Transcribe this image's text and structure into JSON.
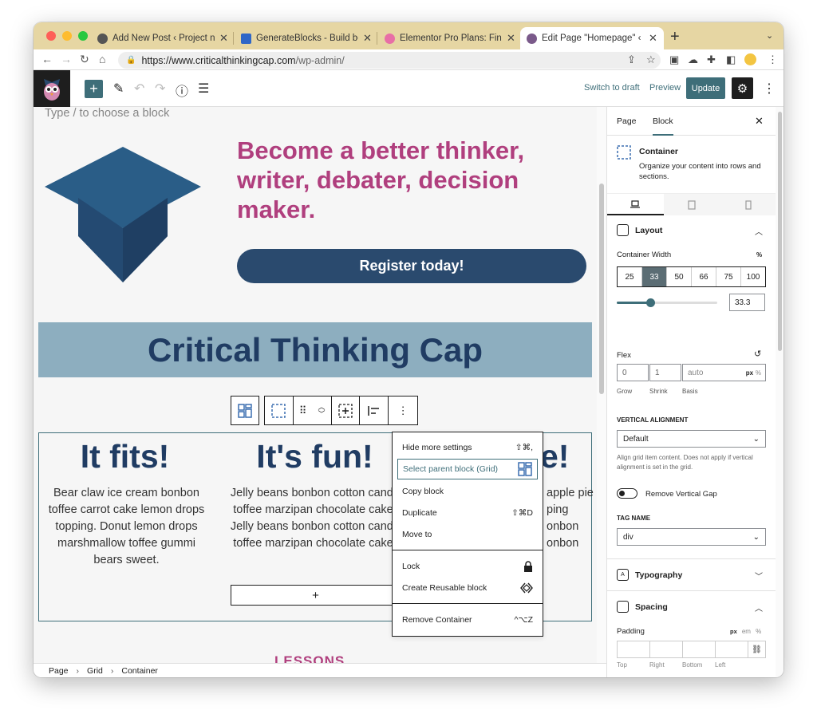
{
  "browser": {
    "tabs": [
      {
        "title": "Add New Post ‹ Project notes",
        "favicon_color": "#555555"
      },
      {
        "title": "GenerateBlocks - Build better",
        "favicon_color": "#2f67c7"
      },
      {
        "title": "Elementor Pro Plans: Find The",
        "favicon_color": "#e86fa6"
      },
      {
        "title": "Edit Page \"Homepage\" ‹ Critic",
        "favicon_color": "#7a5a8a"
      }
    ],
    "url_host": "https://www.criticalthinkingcap.com",
    "url_path": "/wp-admin/"
  },
  "wp_toolbar": {
    "switch_to_draft": "Switch to draft",
    "preview": "Preview",
    "update": "Update"
  },
  "canvas": {
    "type_hint": "Type / to choose a block",
    "headline": "Become a better thinker, writer, debater, decision maker.",
    "register_button": "Register today!",
    "banner_title": "Critical Thinking Cap",
    "columns": [
      {
        "heading": "It fits!",
        "body": "Bear claw ice cream bonbon toffee carrot cake lemon drops topping. Donut lemon drops marshmallow toffee gummi bears sweet."
      },
      {
        "heading": "It's fun!",
        "body": "Jelly beans bonbon cotton candy toffee marzipan chocolate cake. Jelly beans bonbon cotton candy toffee marzipan chocolate cake."
      },
      {
        "heading": "e!",
        "body": "apple pie\nping\nonbon\nonbon"
      }
    ],
    "add_block": "+",
    "lessons": "LESSONS"
  },
  "context_menu": {
    "items": [
      {
        "label": "Hide more settings",
        "shortcut": "⇧⌘,"
      },
      {
        "label": "Select parent block (Grid)",
        "shortcut": ""
      },
      {
        "label": "Copy block",
        "shortcut": ""
      },
      {
        "label": "Duplicate",
        "shortcut": "⇧⌘D"
      },
      {
        "label": "Move to",
        "shortcut": ""
      },
      {
        "label": "Lock",
        "shortcut": ""
      },
      {
        "label": "Create Reusable block",
        "shortcut": ""
      },
      {
        "label": "Remove Container",
        "shortcut": "^⌥Z"
      }
    ]
  },
  "breadcrumb": [
    "Page",
    "Grid",
    "Container"
  ],
  "sidebar": {
    "tab_page": "Page",
    "tab_block": "Block",
    "block_name": "Container",
    "block_desc": "Organize your content into rows and sections.",
    "layout": {
      "title": "Layout",
      "container_width_label": "Container Width",
      "unit": "%",
      "width_options": [
        "25",
        "33",
        "50",
        "66",
        "75",
        "100"
      ],
      "selected_option": "33",
      "width_value": "33.3",
      "width_fraction": 0.333,
      "flex_label": "Flex",
      "grow_value": "0",
      "shrink_value": "1",
      "basis_placeholder": "auto",
      "basis_units": [
        "px",
        "%"
      ],
      "grow_label": "Grow",
      "shrink_label": "Shrink",
      "basis_label": "Basis",
      "vertical_alignment_label": "VERTICAL ALIGNMENT",
      "vertical_alignment_value": "Default",
      "vertical_alignment_help": "Align grid item content. Does not apply if vertical alignment is set in the grid.",
      "remove_vertical_gap": "Remove Vertical Gap",
      "tag_name_label": "TAG NAME",
      "tag_name_value": "div"
    },
    "typography_title": "Typography",
    "spacing": {
      "title": "Spacing",
      "padding_label": "Padding",
      "units": [
        "px",
        "em",
        "%"
      ],
      "sides": [
        "Top",
        "Right",
        "Bottom",
        "Left"
      ]
    }
  },
  "colors": {
    "accent": "#3e6e79",
    "headline": "#b03f7e",
    "navy": "#203c63",
    "banner": "#8daebf",
    "button": "#2a4a6e"
  }
}
